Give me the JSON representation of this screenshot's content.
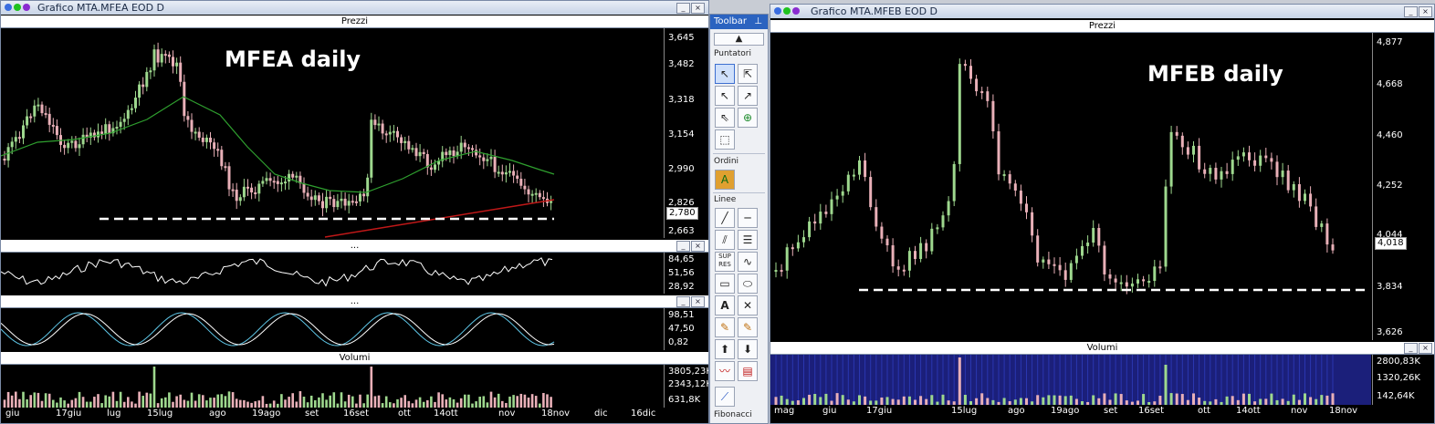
{
  "left_window": {
    "title": "Grafico MTA.MFEA EOD D",
    "price_pane_title": "Prezzi",
    "annotation": "MFEA daily",
    "price_ticks": [
      "3,645",
      "3,482",
      "3,318",
      "3,154",
      "2,990",
      "2,826",
      "2,663"
    ],
    "last_price": "2,780",
    "osc1_title": "...",
    "osc1_ticks": [
      "84,65",
      "51,56",
      "28,92"
    ],
    "osc2_title": "...",
    "osc2_ticks": [
      "98,51",
      "47,50",
      "0,82"
    ],
    "volume_title": "Volumi",
    "volume_ticks": [
      "3805,23K",
      "2343,12K",
      "631,8K"
    ],
    "dates": [
      "giu",
      "17giu",
      "lug",
      "15lug",
      "ago",
      "19ago",
      "set",
      "16set",
      "ott",
      "14ott",
      "nov",
      "18nov",
      "dic",
      "16dic"
    ]
  },
  "right_window": {
    "title": "Grafico MTA.MFEB EOD D",
    "price_pane_title": "Prezzi",
    "annotation": "MFEB daily",
    "price_ticks": [
      "4,877",
      "4,668",
      "4,460",
      "4,252",
      "4,044",
      "3,834",
      "3,626"
    ],
    "last_price": "4,018",
    "volume_title": "Volumi",
    "volume_ticks": [
      "2800,83K",
      "1320,26K",
      "142,64K"
    ],
    "dates": [
      "mag",
      "giu",
      "17giu",
      "15lug",
      "ago",
      "19ago",
      "set",
      "16set",
      "ott",
      "14ott",
      "nov",
      "18nov"
    ]
  },
  "toolbar": {
    "title": "Toolbar",
    "sections": {
      "pointers": "Puntatori",
      "orders": "Ordini",
      "lines": "Linee",
      "fibonacci": "Fibonacci"
    },
    "icons": [
      "arrow-up-icon",
      "pointer-icon",
      "pointer-multi-icon",
      "pointer-select-icon",
      "pointer-crosshair-icon",
      "pointer-edit-icon",
      "zoom-icon",
      "marquee-icon",
      "order-icon",
      "trendline-icon",
      "horizontal-line-icon",
      "parallel-lines-icon",
      "channel-icon",
      "support-resistance-icon",
      "curve-icon",
      "rectangle-icon",
      "ellipse-icon",
      "text-icon",
      "measure-icon",
      "pencil-icon",
      "pencil-x-icon",
      "arrow-up-fill-icon",
      "arrow-down-fill-icon",
      "wave-icon",
      "fibonacci-icon"
    ]
  },
  "colors": {
    "candle_up": "#9ed88e",
    "candle_down": "#e9b0b8",
    "ma_line": "#2fa02f",
    "support_line": "#ffffff",
    "trend_line": "#c01818",
    "volume_bar": "#e9b0b8",
    "volume_right_bg": "#1b1f7a"
  }
}
